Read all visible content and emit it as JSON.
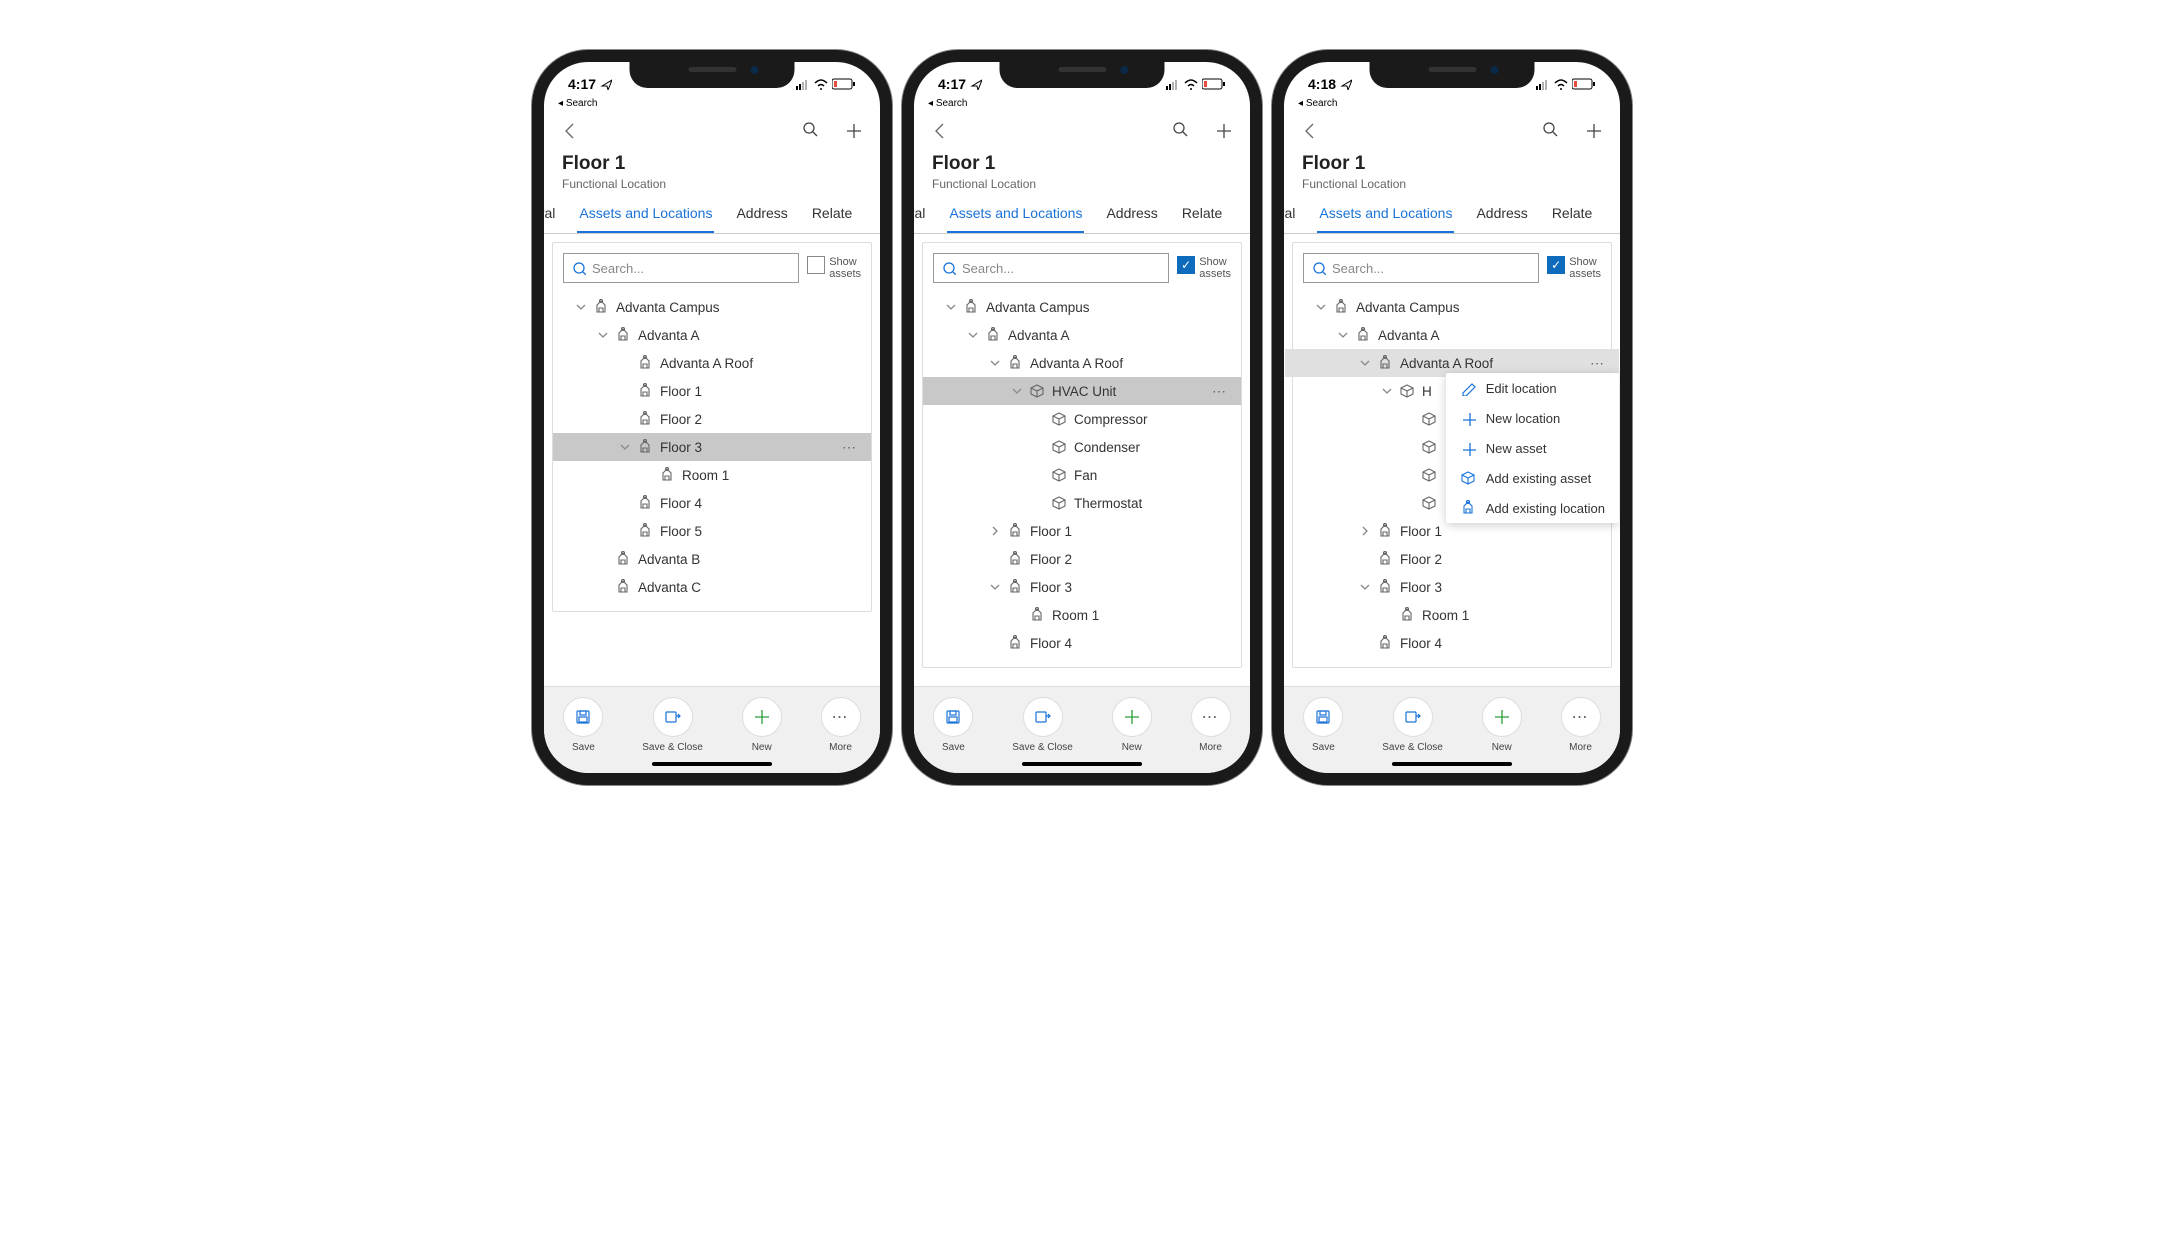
{
  "status": {
    "back_label": "Search",
    "time_a": "4:17",
    "time_c": "4:18"
  },
  "header": {
    "title": "Floor 1",
    "subtitle": "Functional Location"
  },
  "tabs": {
    "t0": "eral",
    "t1": "Assets and Locations",
    "t2": "Address",
    "t3": "Relate"
  },
  "search": {
    "placeholder": "Search...",
    "show_line1": "Show",
    "show_line2": "assets"
  },
  "tree_a": {
    "n0": "Advanta Campus",
    "n1": "Advanta A",
    "n2": "Advanta A Roof",
    "n3": "Floor 1",
    "n4": "Floor 2",
    "n5": "Floor 3",
    "n6": "Room 1",
    "n7": "Floor 4",
    "n8": "Floor 5",
    "n9": "Advanta B",
    "n10": "Advanta C"
  },
  "tree_b": {
    "n0": "Advanta Campus",
    "n1": "Advanta A",
    "n2": "Advanta A Roof",
    "n3": "HVAC Unit",
    "n4": "Compressor",
    "n5": "Condenser",
    "n6": "Fan",
    "n7": "Thermostat",
    "n8": "Floor 1",
    "n9": "Floor 2",
    "n10": "Floor 3",
    "n11": "Room 1",
    "n12": "Floor 4"
  },
  "tree_c": {
    "n0": "Advanta Campus",
    "n1": "Advanta A",
    "n2": "Advanta A Roof",
    "n3": "H",
    "n8": "Floor 1",
    "n9": "Floor 2",
    "n10": "Floor 3",
    "n11": "Room 1",
    "n12": "Floor 4"
  },
  "menu": {
    "m0": "Edit location",
    "m1": "New location",
    "m2": "New asset",
    "m3": "Add existing asset",
    "m4": "Add existing location"
  },
  "bottom": {
    "b0": "Save",
    "b1": "Save & Close",
    "b2": "New",
    "b3": "More"
  }
}
